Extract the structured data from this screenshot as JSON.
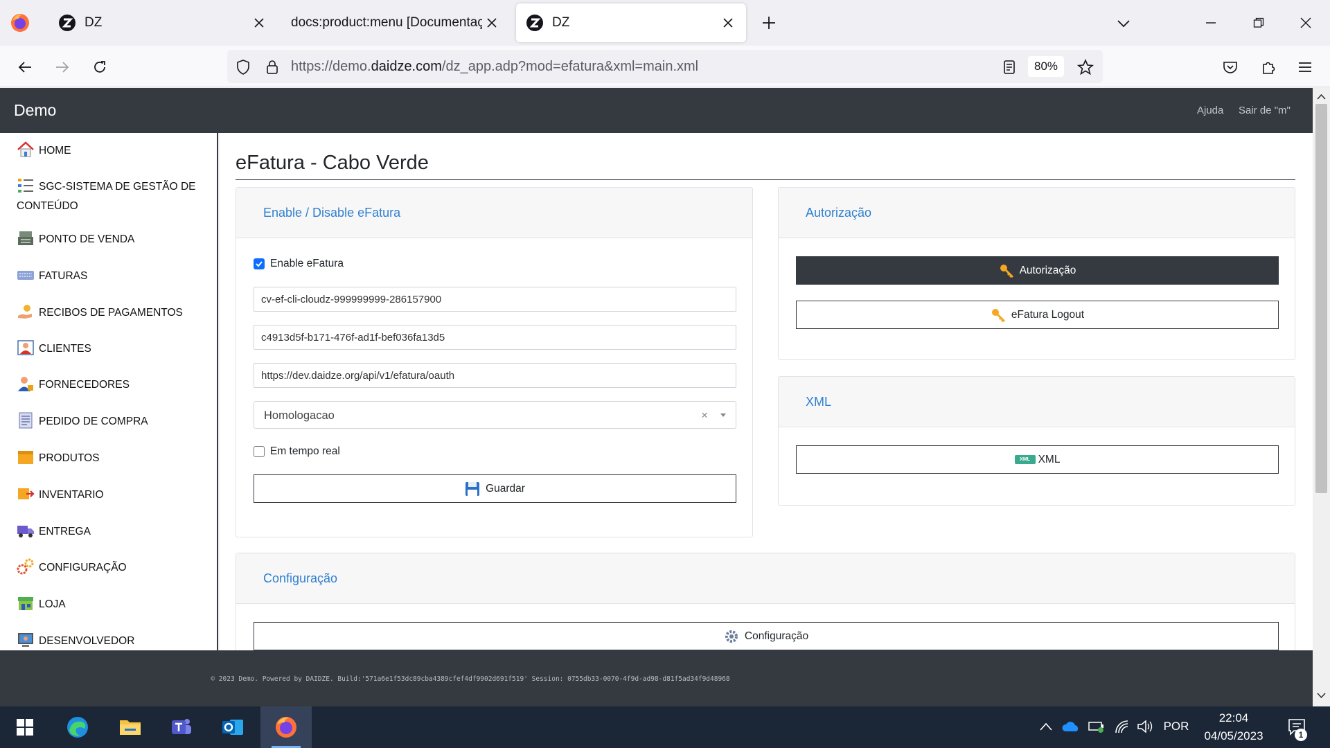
{
  "browser": {
    "tabs": [
      {
        "title": "DZ",
        "active": false
      },
      {
        "title": "docs:product:menu [Documentação",
        "active": false
      },
      {
        "title": "DZ",
        "active": true
      }
    ],
    "url_prefix": "https://demo.",
    "url_domain": "daidze.com",
    "url_path": "/dz_app.adp?mod=efatura&xml=main.xml",
    "zoom": "80%"
  },
  "app": {
    "brand": "Demo",
    "header_links": {
      "help": "Ajuda",
      "logout": "Sair de \"m\""
    }
  },
  "sidebar": {
    "items": [
      {
        "label": "HOME",
        "icon": "home-icon"
      },
      {
        "label": "SGC-SISTEMA DE GESTÃO DE CONTEÚDO",
        "icon": "list-icon"
      },
      {
        "label": "PONTO DE VENDA",
        "icon": "cash-register-icon"
      },
      {
        "label": "FATURAS",
        "icon": "keyboard-icon"
      },
      {
        "label": "RECIBOS DE PAGAMENTOS",
        "icon": "payment-hand-icon"
      },
      {
        "label": "CLIENTES",
        "icon": "client-icon"
      },
      {
        "label": "FORNECEDORES",
        "icon": "supplier-icon"
      },
      {
        "label": "PEDIDO DE COMPRA",
        "icon": "document-icon"
      },
      {
        "label": "PRODUTOS",
        "icon": "box-icon"
      },
      {
        "label": "INVENTARIO",
        "icon": "inventory-icon"
      },
      {
        "label": "ENTREGA",
        "icon": "truck-icon"
      },
      {
        "label": "CONFIGURAÇÃO",
        "icon": "gears-icon"
      },
      {
        "label": "LOJA",
        "icon": "store-icon"
      },
      {
        "label": "DESENVOLVEDOR",
        "icon": "developer-icon"
      }
    ]
  },
  "page": {
    "title": "eFatura - Cabo Verde",
    "enable_card": {
      "title": "Enable / Disable eFatura",
      "enable_label": "Enable eFatura",
      "enable_checked": true,
      "client_id": "cv-ef-cli-cloudz-999999999-286157900",
      "client_secret": "c4913d5f-b171-476f-ad1f-bef036fa13d5",
      "oauth_url": "https://dev.daidze.org/api/v1/efatura/oauth",
      "environment": "Homologacao",
      "clear_symbol": "×",
      "realtime_label": "Em tempo real",
      "realtime_checked": false,
      "save_label": "Guardar"
    },
    "auth_card": {
      "title": "Autorização",
      "auth_button": "Autorização",
      "logout_button": "eFatura Logout"
    },
    "xml_card": {
      "title": "XML",
      "xml_button": "XML",
      "xml_badge": "XML"
    },
    "config_card": {
      "title": "Configuração",
      "config_button": "Configuração"
    }
  },
  "footer": {
    "text": "© 2023 Demo. Powered by DAIDZE. Build:'571a6e1f53dc89cba4389cfef4df9902d691f519' Session: 0755db33-0070-4f9d-ad98-d81f5ad34f9d48968"
  },
  "taskbar": {
    "language": "POR",
    "time": "22:04",
    "date": "04/05/2023",
    "notification_count": "1"
  },
  "colors": {
    "header_bg": "#343a40",
    "link_blue": "#2f7fcf",
    "taskbar_bg": "#1b2636"
  }
}
